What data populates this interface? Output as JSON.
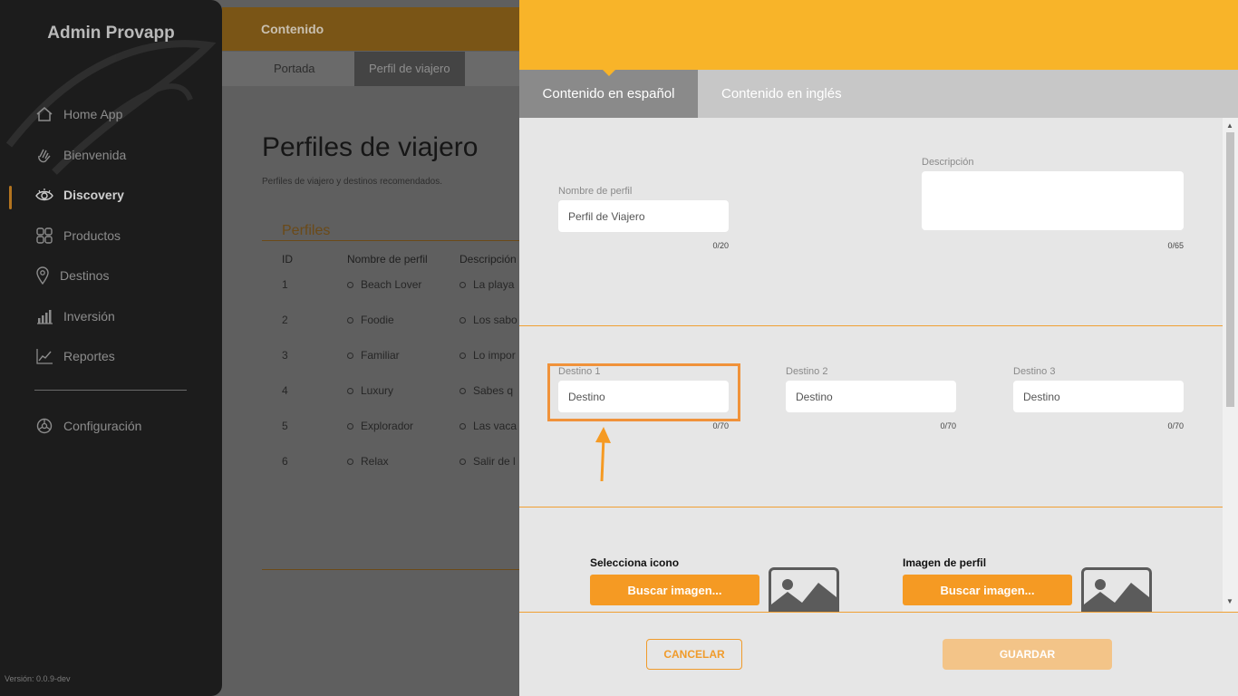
{
  "sidebar": {
    "brand": "Admin Provapp",
    "items": [
      {
        "label": "Home App",
        "icon": "home-icon"
      },
      {
        "label": "Bienvenida",
        "icon": "wave-hand-icon"
      },
      {
        "label": "Discovery",
        "icon": "eye-icon"
      },
      {
        "label": "Productos",
        "icon": "grid-icon"
      },
      {
        "label": "Destinos",
        "icon": "map-pin-icon"
      },
      {
        "label": "Inversión",
        "icon": "bar-chart-icon"
      },
      {
        "label": "Reportes",
        "icon": "line-chart-icon"
      }
    ],
    "settings_label": "Configuración",
    "version": "Versión: 0.0.9-dev"
  },
  "main": {
    "section_title": "Contenido",
    "subtabs": [
      "Portada",
      "Perfil de viajero"
    ],
    "page_title": "Perfiles de viajero",
    "page_subtitle": "Perfiles de viajero y destinos recomendados.",
    "table_section": "Perfiles",
    "table_headers": [
      "ID",
      "Nombre de perfil",
      "Descripción"
    ],
    "rows": [
      {
        "id": "1",
        "name": "Beach Lover",
        "desc": "La playa"
      },
      {
        "id": "2",
        "name": "Foodie",
        "desc": "Los sabo"
      },
      {
        "id": "3",
        "name": "Familiar",
        "desc": "Lo impor"
      },
      {
        "id": "4",
        "name": "Luxury",
        "desc": "Sabes q"
      },
      {
        "id": "5",
        "name": "Explorador",
        "desc": "Las vaca"
      },
      {
        "id": "6",
        "name": "Relax",
        "desc": "Salir de l"
      }
    ]
  },
  "modal": {
    "tabs": [
      "Contenido en español",
      "Contenido en inglés"
    ],
    "profile_name": {
      "label": "Nombre de perfil",
      "value": "Perfil de Viajero",
      "counter": "0/20"
    },
    "description": {
      "label": "Descripción",
      "value": "",
      "counter": "0/65"
    },
    "destinations": [
      {
        "label": "Destino 1",
        "placeholder": "Destino",
        "counter": "0/70"
      },
      {
        "label": "Destino 2",
        "placeholder": "Destino",
        "counter": "0/70"
      },
      {
        "label": "Destino 3",
        "placeholder": "Destino",
        "counter": "0/70"
      }
    ],
    "icon_picker": {
      "label": "Selecciona icono",
      "button": "Buscar imagen..."
    },
    "image_picker": {
      "label": "Imagen de perfil",
      "button": "Buscar imagen..."
    },
    "cancel_label": "CANCELAR",
    "save_label": "GUARDAR"
  },
  "colors": {
    "accent": "#f8b429",
    "button_orange": "#f59a23",
    "highlight": "#f0923a"
  }
}
